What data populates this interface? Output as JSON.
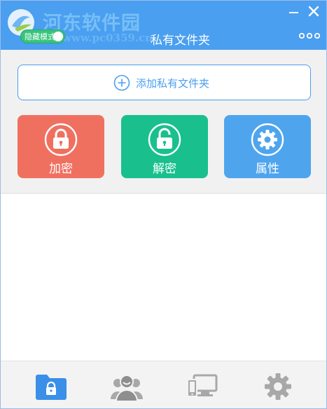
{
  "app": {
    "title": "私有文件夹",
    "watermark": {
      "name": "河东软件园",
      "url": "www.pc0359.cn"
    },
    "mode_toggle_label": "隐藏模式",
    "colors": {
      "titlebar": "#4a9ff0",
      "encrypt": "#f07060",
      "decrypt": "#19c08e",
      "properties": "#4ea5ee",
      "toggle": "#37c47c"
    }
  },
  "window_controls": {
    "minimize_icon": "minimize-icon",
    "close_icon": "close-icon",
    "more_icon": "more-dots-icon"
  },
  "toolbar": {
    "add_folder_label": "添加私有文件夹",
    "actions": [
      {
        "label": "加密",
        "icon": "lock-closed-icon"
      },
      {
        "label": "解密",
        "icon": "lock-open-icon"
      },
      {
        "label": "属性",
        "icon": "gear-icon"
      }
    ]
  },
  "bottom_nav": [
    {
      "icon": "private-folder-icon",
      "active": true
    },
    {
      "icon": "users-icon",
      "active": false
    },
    {
      "icon": "devices-icon",
      "active": false
    },
    {
      "icon": "settings-icon",
      "active": false
    }
  ]
}
